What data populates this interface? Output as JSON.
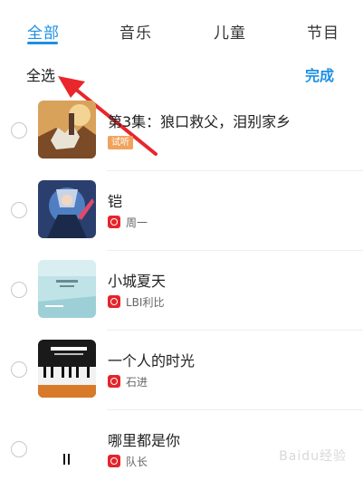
{
  "tabs": [
    {
      "label": "全部",
      "active": true
    },
    {
      "label": "音乐",
      "active": false
    },
    {
      "label": "儿童",
      "active": false
    },
    {
      "label": "节目",
      "active": false
    }
  ],
  "toolbar": {
    "select_all": "全选",
    "done": "完成"
  },
  "colors": {
    "accent": "#1b8fe6",
    "annotation_arrow": "#e8262b",
    "trial_badge": "#f0a35e",
    "source_icon": "#e5242b"
  },
  "items": [
    {
      "title": "第3集：狼口救父，泪别家乡",
      "badge": "试听",
      "artist": ""
    },
    {
      "title": "铠",
      "badge": "",
      "artist": "周一"
    },
    {
      "title": "小城夏天",
      "badge": "",
      "artist": "LBI利比"
    },
    {
      "title": "一个人的时光",
      "badge": "",
      "artist": "石进"
    },
    {
      "title": "哪里都是你",
      "badge": "",
      "artist": "队长"
    }
  ],
  "watermark": "Baidu经验"
}
